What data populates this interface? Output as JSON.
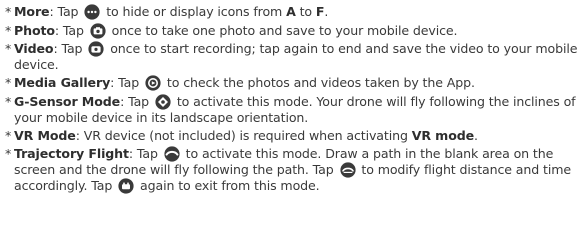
{
  "items": [
    {
      "bullet": "*",
      "title": "More",
      "t1": ": Tap ",
      "icon": "more-icon",
      "t2": " to hide or display icons from ",
      "kA": "A",
      "t3": " to ",
      "kF": "F",
      "t4": "."
    },
    {
      "bullet": "*",
      "title": "Photo",
      "t1": ": Tap ",
      "icon": "camera-icon",
      "t2": " once to take one photo and save to your mobile device."
    },
    {
      "bullet": "*",
      "title": "Video",
      "t1": ": Tap ",
      "icon": "video-camera-icon",
      "t2": " once to start recording; tap again to end and save the video to your mobile device."
    },
    {
      "bullet": "*",
      "title": "Media Gallery",
      "t1": ": Tap ",
      "icon": "gallery-icon",
      "t2": " to check the photos and videos taken by the App."
    },
    {
      "bullet": "*",
      "title": "G-Sensor Mode",
      "t1": ":  Tap ",
      "icon": "g-sensor-icon",
      "t2": " to activate this mode. Your drone will fly following the inclines of your mobile device in its landscape orientation."
    },
    {
      "bullet": "*",
      "title": "VR Mode",
      "t1": ":  VR device (not included) is required when activating ",
      "kVR": "VR mode",
      "t2": "."
    },
    {
      "bullet": "*",
      "title": "Trajectory Flight",
      "t1": ": Tap ",
      "icon": "trajectory-icon",
      "t2": " to activate this mode. Draw a path in the blank area on the screen and the drone will fly following the path. Tap ",
      "icon2": "trajectory-edit-icon",
      "t3": " to modify flight distance and time accordingly. Tap ",
      "icon3": "trajectory-exit-icon",
      "t4": " again to exit from this mode."
    }
  ],
  "colors": {
    "text": "#3a3a3a",
    "icon": "#3a3a3a"
  }
}
